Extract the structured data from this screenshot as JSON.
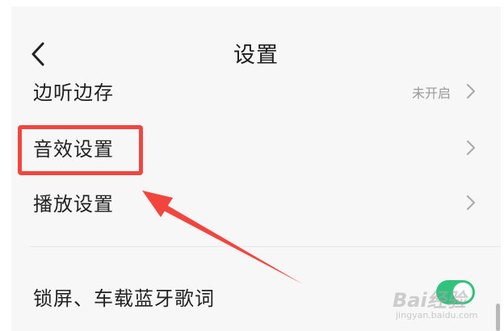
{
  "header": {
    "title": "设置"
  },
  "settings": {
    "items": [
      {
        "label": "边听边存",
        "value": "未开启"
      },
      {
        "label": "音效设置",
        "value": ""
      },
      {
        "label": "播放设置",
        "value": ""
      },
      {
        "label": "锁屏、车载蓝牙歌词",
        "toggle_on": true
      }
    ]
  },
  "annotation": {
    "highlight_color": "#f2453d"
  },
  "watermark": {
    "main": "Bai经验",
    "sub": "jingyan.baidu.com"
  },
  "colors": {
    "toggle_on": "#31c27c",
    "text_primary": "#222222",
    "text_secondary": "#9a9a9a"
  }
}
